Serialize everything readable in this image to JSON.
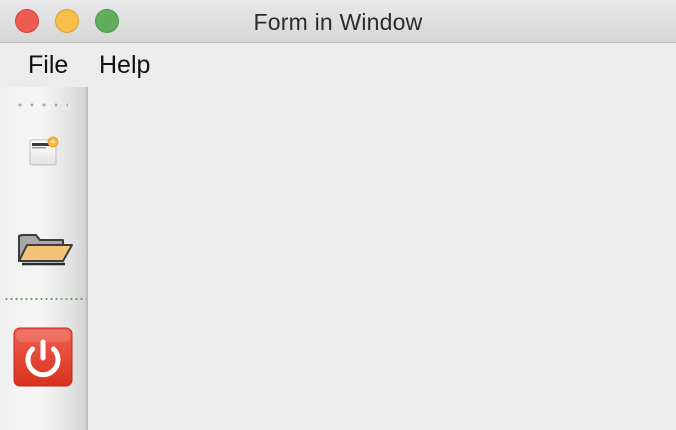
{
  "window": {
    "title": "Form in Window"
  },
  "menubar": {
    "items": [
      {
        "label": "File"
      },
      {
        "label": "Help"
      }
    ]
  },
  "toolbar": {
    "buttons": [
      {
        "icon": "new-document-icon"
      },
      {
        "icon": "open-folder-icon"
      },
      {
        "icon": "power-quit-icon"
      }
    ]
  },
  "colors": {
    "close": "#ee5b52",
    "minimize": "#f8bd4a",
    "zoom": "#5fad5d",
    "quit_button": "#e2402f",
    "folder": "#f2c277",
    "separator": "#5aa05a"
  }
}
